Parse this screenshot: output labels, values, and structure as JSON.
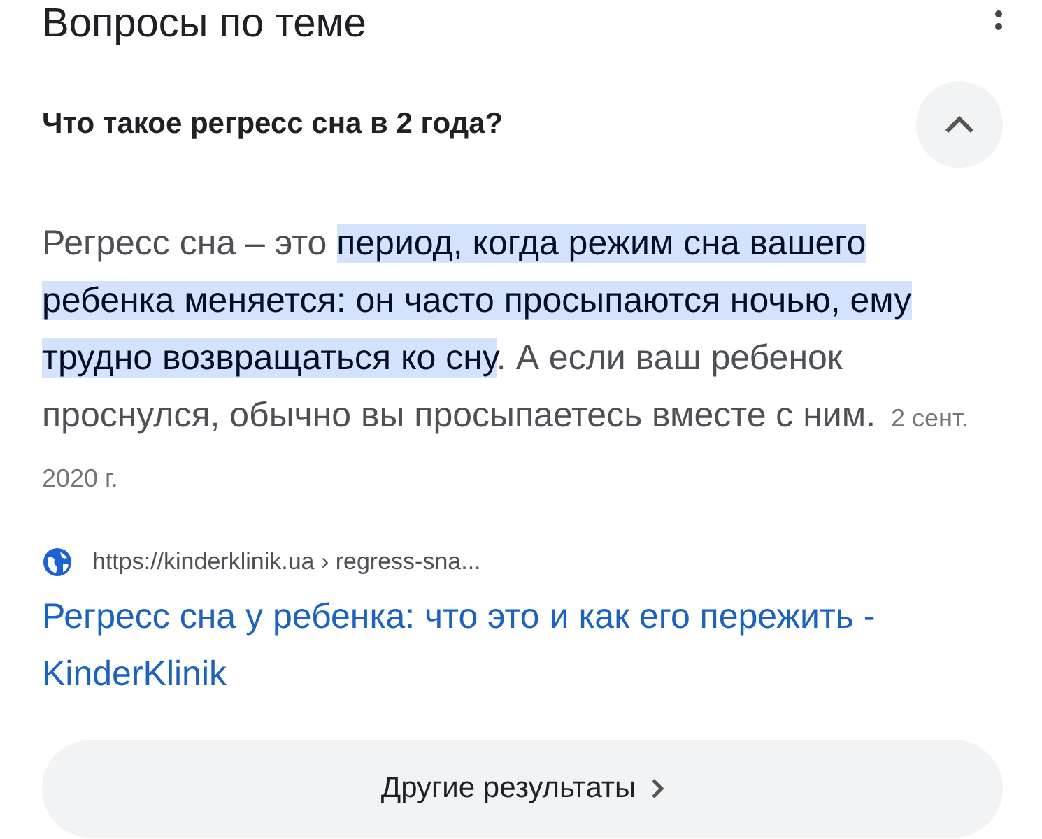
{
  "section_title": "Вопросы по теме",
  "question": {
    "text": "Что такое регресс сна в 2 года?",
    "expanded": true
  },
  "answer": {
    "segments": [
      {
        "text": "Регресс сна – это ",
        "highlighted": false
      },
      {
        "text": "период, когда режим сна вашего ребенка меняется: он часто просыпаются ночью, ему трудно возвращаться ко сну",
        "highlighted": true
      },
      {
        "text": ". А если ваш ребенок проснулся, обычно вы просыпаетесь вместе с ним.",
        "highlighted": false
      }
    ],
    "date": "2 сент. 2020 г."
  },
  "source": {
    "url": "https://kinderklinik.ua › regress-sna...",
    "title": "Регресс сна у ребенка: что это и как его пережить - KinderKlinik"
  },
  "more_button": "Другие результаты"
}
